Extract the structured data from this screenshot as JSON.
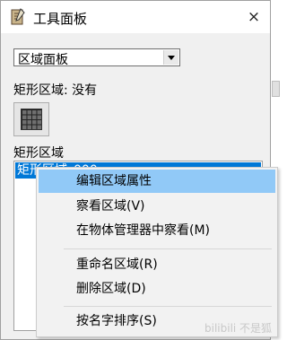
{
  "window": {
    "title": "工具面板",
    "close_label": "×"
  },
  "region_select": {
    "value": "区域面板"
  },
  "rect_status": "矩形区域: 没有",
  "list": {
    "label": "矩形区域",
    "items": [
      "矩形区域_000"
    ]
  },
  "context_menu": {
    "items": [
      "编辑区域属性",
      "察看区域(V)",
      "在物体管理器中察看(M)",
      "重命名区域(R)",
      "删除区域(D)",
      "按名字排序(S)"
    ],
    "highlighted_index": 0
  },
  "watermark": "bilibili  不是狐"
}
